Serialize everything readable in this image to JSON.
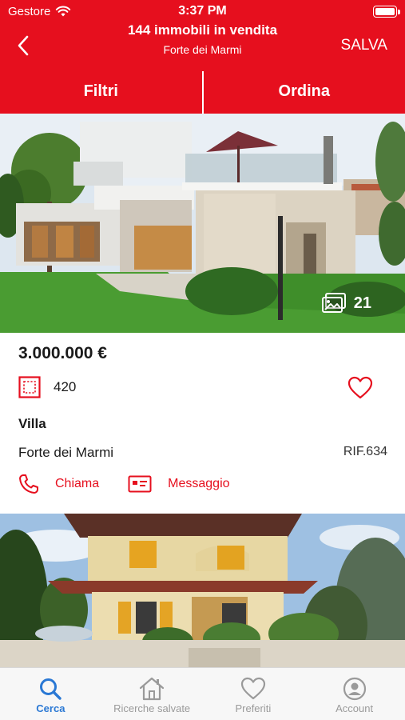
{
  "status_bar": {
    "carrier": "Gestore",
    "time": "3:37 PM"
  },
  "nav": {
    "title": "144 immobili in vendita",
    "subtitle": "Forte dei Marmi",
    "save_label": "SALVA"
  },
  "filters": {
    "filter_label": "Filtri",
    "sort_label": "Ordina"
  },
  "listing": {
    "photo_count": "21",
    "price": "3.000.000 €",
    "area": "420",
    "type": "Villa",
    "location": "Forte dei Marmi",
    "reference": "RIF.634",
    "call_label": "Chiama",
    "message_label": "Messaggio"
  },
  "tabs": [
    {
      "label": "Cerca",
      "icon": "search-icon",
      "active": true
    },
    {
      "label": "Ricerche salvate",
      "icon": "house-icon",
      "active": false
    },
    {
      "label": "Preferiti",
      "icon": "heart-icon",
      "active": false
    },
    {
      "label": "Account",
      "icon": "account-icon",
      "active": false
    }
  ],
  "colors": {
    "brand": "#e60f1e",
    "tab_active": "#2a78d4",
    "tab_inactive": "#9a9a9a"
  }
}
